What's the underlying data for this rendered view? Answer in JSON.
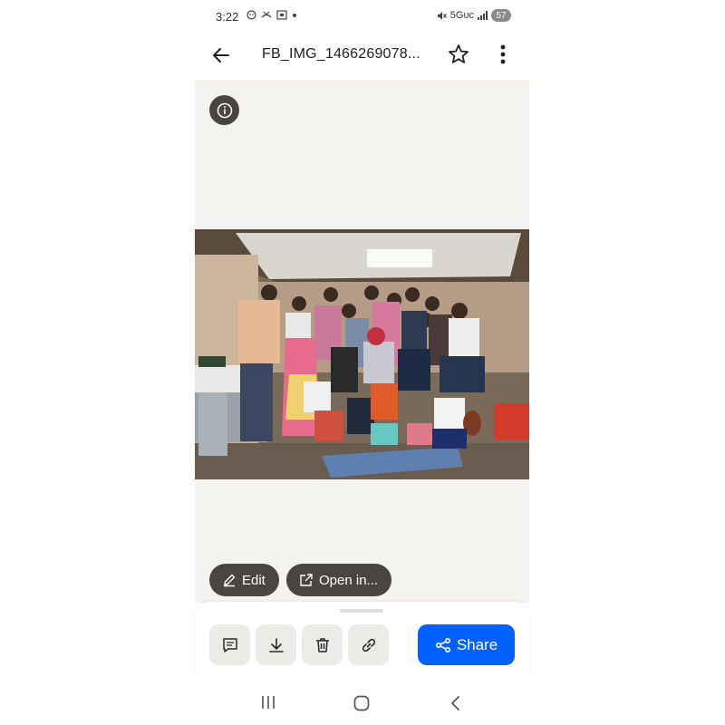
{
  "status_bar": {
    "time": "3:22",
    "network": "5Gᴜᴄ",
    "battery": "57"
  },
  "app_bar": {
    "title": "FB_IMG_1466269078...",
    "back_icon": "arrow-left-icon",
    "favorite_icon": "star-outline-icon",
    "more_icon": "more-vertical-icon"
  },
  "viewer": {
    "info_icon": "info-icon",
    "edit_label": "Edit",
    "open_label": "Open in..."
  },
  "actions": {
    "comment_icon": "comment-icon",
    "download_icon": "download-icon",
    "delete_icon": "trash-icon",
    "link_icon": "link-icon",
    "share_label": "Share",
    "accent_color": "#0061fe"
  },
  "nav": {
    "recents_icon": "recents-icon",
    "home_icon": "home-icon",
    "back_icon": "back-chevron-icon"
  }
}
